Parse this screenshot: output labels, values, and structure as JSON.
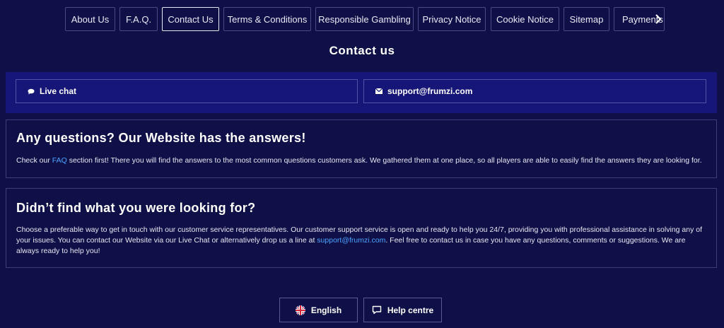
{
  "nav": {
    "tabs": [
      {
        "label": "About Us"
      },
      {
        "label": "F.A.Q."
      },
      {
        "label": "Contact Us",
        "active": true
      },
      {
        "label": "Terms & Conditions"
      },
      {
        "label": "Responsible Gambling"
      },
      {
        "label": "Privacy Notice"
      },
      {
        "label": "Cookie Notice"
      },
      {
        "label": "Sitemap"
      },
      {
        "label": "Payments"
      }
    ],
    "next_icon": "chevron-right-icon"
  },
  "page": {
    "title": "Contact us"
  },
  "contact": {
    "live_chat_label": "Live chat",
    "live_chat_icon": "chat-bubble-icon",
    "email_label": "support@frumzi.com",
    "email_icon": "envelope-icon"
  },
  "faq_panel": {
    "heading": "Any questions? Our Website has the answers!",
    "text_before": "Check our ",
    "link_text": "FAQ",
    "text_after": " section first! There you will find the answers to the most common questions customers ask. We gathered them at one place, so all players are able to easily find the answers they are looking for."
  },
  "help_panel": {
    "heading": "Didn’t find what you were looking for?",
    "text_before": "Choose a preferable way to get in touch with our customer service representatives. Our customer support service is open and ready to help you 24/7, providing you with professional assistance in solving any of your issues. You can contact our Website via our Live Chat or alternatively drop us a line at ",
    "link_text": "support@frumzi.com",
    "text_after": ". Feel free to contact us in case you have any questions, comments or suggestions. We are always ready to help you!"
  },
  "footer": {
    "language_label": "English",
    "language_icon": "uk-flag-icon",
    "help_label": "Help centre",
    "help_icon": "chat-bubble-outline-icon"
  },
  "colors": {
    "background": "#101048",
    "contact_band": "#161678",
    "link": "#4da3ff",
    "text": "#ffffff"
  }
}
